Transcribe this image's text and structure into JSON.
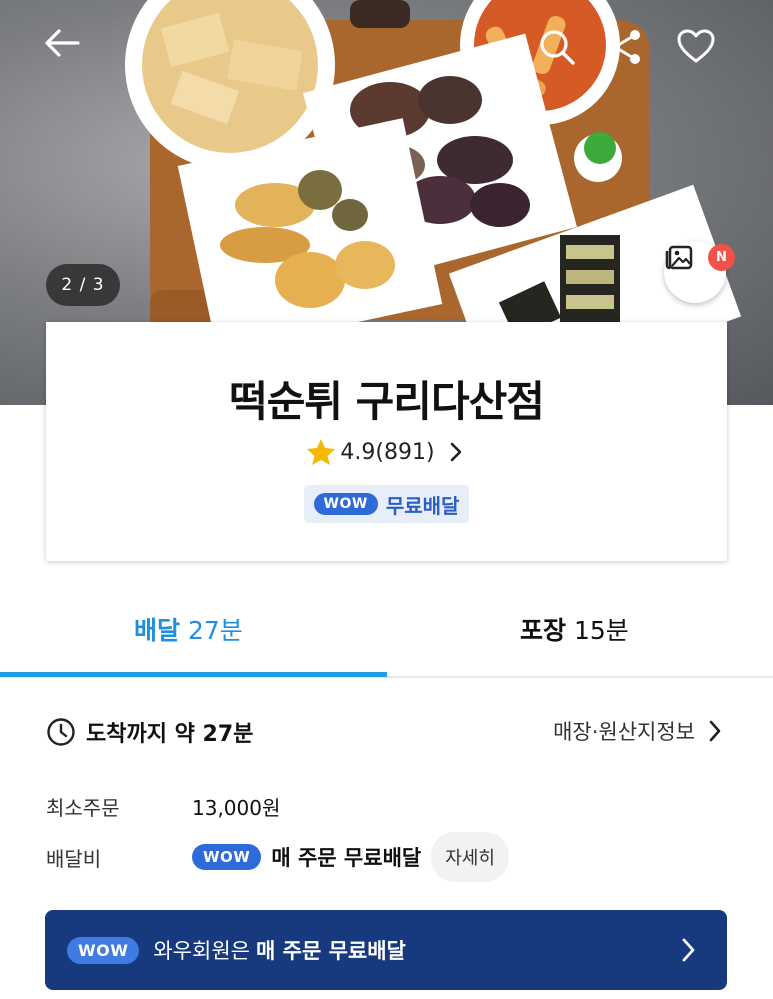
{
  "hero": {
    "image_counter": "2 / 3",
    "new_badge": "N"
  },
  "icons": {
    "back": "back-arrow-icon",
    "search": "search-icon",
    "share": "share-icon",
    "favorite": "heart-icon",
    "photos": "photo-gallery-icon",
    "rating": "star-icon",
    "clock": "clock-icon",
    "chevron": "chevron-right-icon"
  },
  "store": {
    "name": "떡순튀 구리다산점",
    "rating": "4.9",
    "review_count": "(891)",
    "wow_label": "WOW",
    "free_delivery": "무료배달"
  },
  "tabs": [
    {
      "name": "배달",
      "time": "27분",
      "active": true
    },
    {
      "name": "포장",
      "time": "15분",
      "active": false
    }
  ],
  "info": {
    "arrival_text": "도착까지 약 27분",
    "origin_link": "매장·원산지정보",
    "min_order_label": "최소주문",
    "min_order_value": "13,000원",
    "delivery_fee_label": "배달비",
    "delivery_fee_wow": "WOW",
    "delivery_fee_text": "매 주문 무료배달",
    "detail_button": "자세히"
  },
  "banner": {
    "wow": "WOW",
    "text": "와우회원은",
    "bold_text": "매 주문 무료배달"
  },
  "colors": {
    "accent_blue": "#1f8fe0",
    "wow_blue": "#2e6ad8",
    "banner_navy": "#173a7e",
    "star": "#f5b800",
    "badge_red": "#f0524a"
  }
}
